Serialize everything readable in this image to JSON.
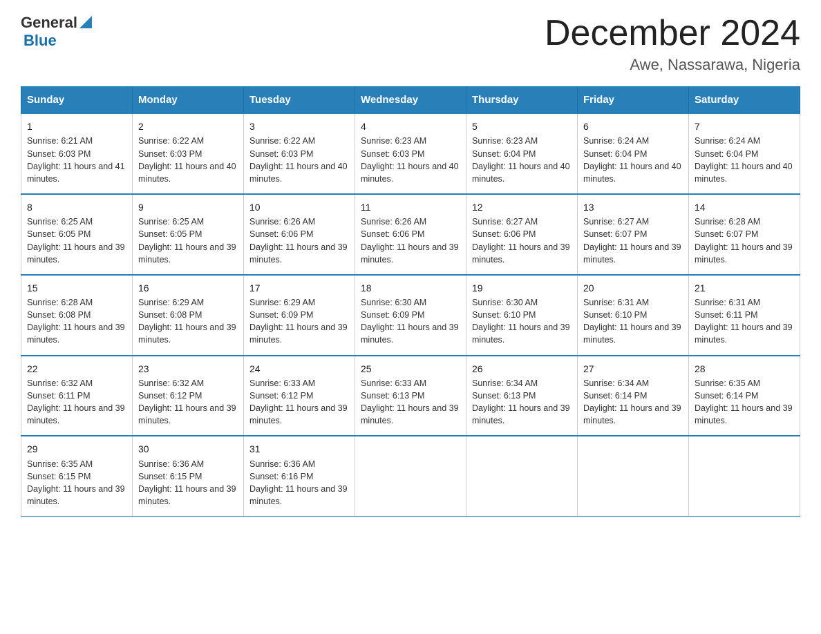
{
  "header": {
    "logo_general": "General",
    "logo_blue": "Blue",
    "title": "December 2024",
    "subtitle": "Awe, Nassarawa, Nigeria"
  },
  "days": [
    "Sunday",
    "Monday",
    "Tuesday",
    "Wednesday",
    "Thursday",
    "Friday",
    "Saturday"
  ],
  "weeks": [
    [
      {
        "num": "1",
        "sunrise": "6:21 AM",
        "sunset": "6:03 PM",
        "daylight": "11 hours and 41 minutes."
      },
      {
        "num": "2",
        "sunrise": "6:22 AM",
        "sunset": "6:03 PM",
        "daylight": "11 hours and 40 minutes."
      },
      {
        "num": "3",
        "sunrise": "6:22 AM",
        "sunset": "6:03 PM",
        "daylight": "11 hours and 40 minutes."
      },
      {
        "num": "4",
        "sunrise": "6:23 AM",
        "sunset": "6:03 PM",
        "daylight": "11 hours and 40 minutes."
      },
      {
        "num": "5",
        "sunrise": "6:23 AM",
        "sunset": "6:04 PM",
        "daylight": "11 hours and 40 minutes."
      },
      {
        "num": "6",
        "sunrise": "6:24 AM",
        "sunset": "6:04 PM",
        "daylight": "11 hours and 40 minutes."
      },
      {
        "num": "7",
        "sunrise": "6:24 AM",
        "sunset": "6:04 PM",
        "daylight": "11 hours and 40 minutes."
      }
    ],
    [
      {
        "num": "8",
        "sunrise": "6:25 AM",
        "sunset": "6:05 PM",
        "daylight": "11 hours and 39 minutes."
      },
      {
        "num": "9",
        "sunrise": "6:25 AM",
        "sunset": "6:05 PM",
        "daylight": "11 hours and 39 minutes."
      },
      {
        "num": "10",
        "sunrise": "6:26 AM",
        "sunset": "6:06 PM",
        "daylight": "11 hours and 39 minutes."
      },
      {
        "num": "11",
        "sunrise": "6:26 AM",
        "sunset": "6:06 PM",
        "daylight": "11 hours and 39 minutes."
      },
      {
        "num": "12",
        "sunrise": "6:27 AM",
        "sunset": "6:06 PM",
        "daylight": "11 hours and 39 minutes."
      },
      {
        "num": "13",
        "sunrise": "6:27 AM",
        "sunset": "6:07 PM",
        "daylight": "11 hours and 39 minutes."
      },
      {
        "num": "14",
        "sunrise": "6:28 AM",
        "sunset": "6:07 PM",
        "daylight": "11 hours and 39 minutes."
      }
    ],
    [
      {
        "num": "15",
        "sunrise": "6:28 AM",
        "sunset": "6:08 PM",
        "daylight": "11 hours and 39 minutes."
      },
      {
        "num": "16",
        "sunrise": "6:29 AM",
        "sunset": "6:08 PM",
        "daylight": "11 hours and 39 minutes."
      },
      {
        "num": "17",
        "sunrise": "6:29 AM",
        "sunset": "6:09 PM",
        "daylight": "11 hours and 39 minutes."
      },
      {
        "num": "18",
        "sunrise": "6:30 AM",
        "sunset": "6:09 PM",
        "daylight": "11 hours and 39 minutes."
      },
      {
        "num": "19",
        "sunrise": "6:30 AM",
        "sunset": "6:10 PM",
        "daylight": "11 hours and 39 minutes."
      },
      {
        "num": "20",
        "sunrise": "6:31 AM",
        "sunset": "6:10 PM",
        "daylight": "11 hours and 39 minutes."
      },
      {
        "num": "21",
        "sunrise": "6:31 AM",
        "sunset": "6:11 PM",
        "daylight": "11 hours and 39 minutes."
      }
    ],
    [
      {
        "num": "22",
        "sunrise": "6:32 AM",
        "sunset": "6:11 PM",
        "daylight": "11 hours and 39 minutes."
      },
      {
        "num": "23",
        "sunrise": "6:32 AM",
        "sunset": "6:12 PM",
        "daylight": "11 hours and 39 minutes."
      },
      {
        "num": "24",
        "sunrise": "6:33 AM",
        "sunset": "6:12 PM",
        "daylight": "11 hours and 39 minutes."
      },
      {
        "num": "25",
        "sunrise": "6:33 AM",
        "sunset": "6:13 PM",
        "daylight": "11 hours and 39 minutes."
      },
      {
        "num": "26",
        "sunrise": "6:34 AM",
        "sunset": "6:13 PM",
        "daylight": "11 hours and 39 minutes."
      },
      {
        "num": "27",
        "sunrise": "6:34 AM",
        "sunset": "6:14 PM",
        "daylight": "11 hours and 39 minutes."
      },
      {
        "num": "28",
        "sunrise": "6:35 AM",
        "sunset": "6:14 PM",
        "daylight": "11 hours and 39 minutes."
      }
    ],
    [
      {
        "num": "29",
        "sunrise": "6:35 AM",
        "sunset": "6:15 PM",
        "daylight": "11 hours and 39 minutes."
      },
      {
        "num": "30",
        "sunrise": "6:36 AM",
        "sunset": "6:15 PM",
        "daylight": "11 hours and 39 minutes."
      },
      {
        "num": "31",
        "sunrise": "6:36 AM",
        "sunset": "6:16 PM",
        "daylight": "11 hours and 39 minutes."
      },
      null,
      null,
      null,
      null
    ]
  ]
}
